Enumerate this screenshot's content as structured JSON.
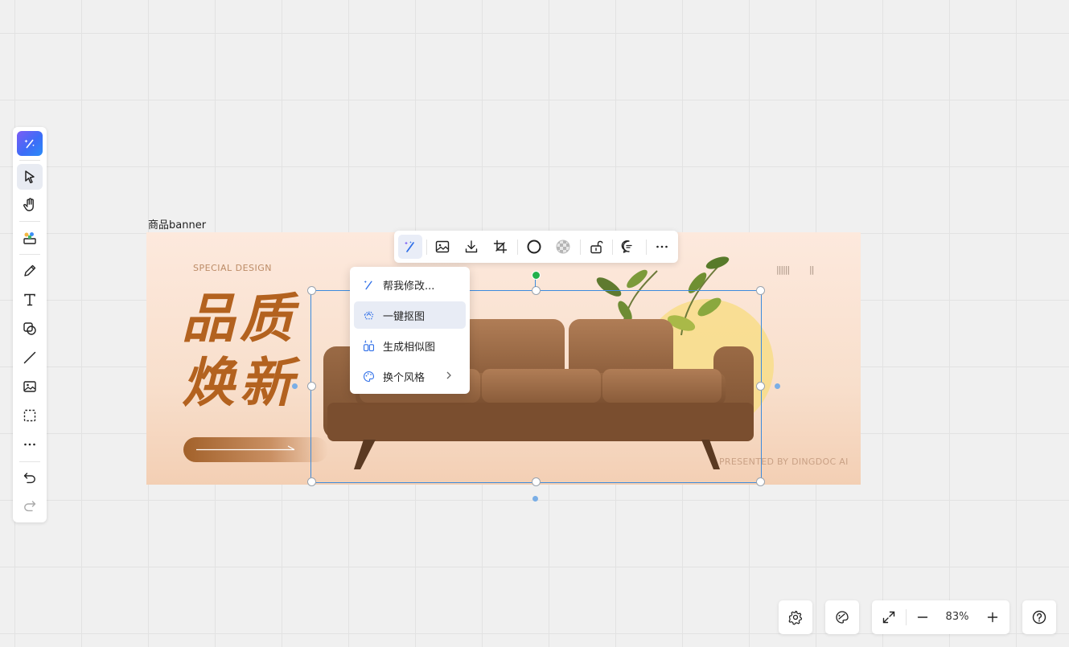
{
  "frame": {
    "label": "商品banner"
  },
  "banner": {
    "tagline": "SPECIAL DESIGN",
    "title_line1": "品质",
    "title_line2": "焕新",
    "footer": "PRESENTED BY DINGDOC AI",
    "barcode_left": "||||||",
    "barcode_right": "||"
  },
  "ai_menu": {
    "items": [
      {
        "label": "帮我修改...",
        "icon": "magic-wand-icon"
      },
      {
        "label": "一键抠图",
        "icon": "cutout-icon",
        "highlighted": true
      },
      {
        "label": "生成相似图",
        "icon": "similar-image-icon"
      },
      {
        "label": "换个风格",
        "icon": "palette-icon",
        "has_submenu": true
      }
    ]
  },
  "floating_toolbar": {
    "buttons": [
      "ai-edit-icon",
      "replace-image-icon",
      "download-icon",
      "crop-icon",
      "border-icon",
      "transparency-icon",
      "unlock-icon",
      "comment-icon",
      "more-icon"
    ]
  },
  "left_toolbar": {
    "tools": [
      "ai-assistant-icon",
      "select-icon",
      "hand-icon",
      "template-icon",
      "pen-icon",
      "text-icon",
      "shape-icon",
      "line-icon",
      "image-icon",
      "frame-icon",
      "more-icon",
      "undo-icon",
      "redo-icon"
    ],
    "active": "select-icon"
  },
  "zoom": {
    "level": "83%"
  },
  "colors": {
    "accent": "#3c8bdd",
    "title_brown": "#b3621f",
    "ai_gradient_start": "#7b5cf5",
    "ai_gradient_end": "#2a8cf7"
  }
}
